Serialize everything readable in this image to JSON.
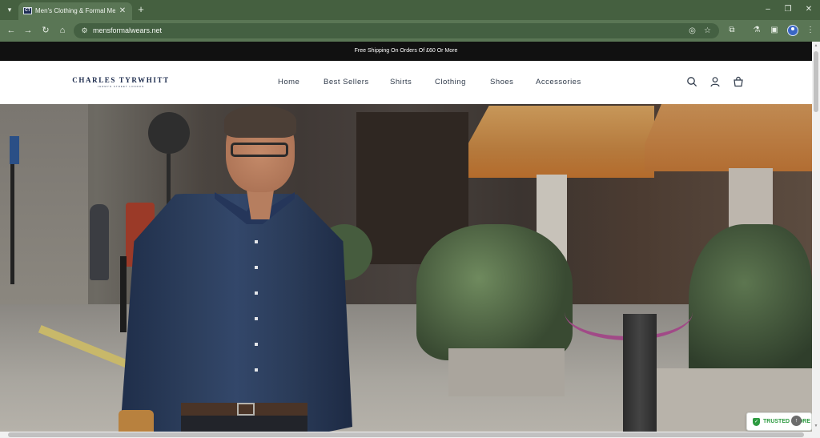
{
  "browser": {
    "tab_title": "Men's Clothing & Formal Men",
    "favicon_text": "CT",
    "tab_close": "✕",
    "new_tab": "+",
    "url": "mensformalwears.net",
    "icons": [
      "tab-search-icon",
      "back-icon",
      "forward-icon",
      "reload-icon",
      "home-icon",
      "site-info-icon",
      "eye-off-icon",
      "star-icon",
      "extensions-icon",
      "labs-icon",
      "sidebar-icon",
      "profile-icon",
      "menu-icon",
      "minimize-icon",
      "maximize-icon",
      "close-window-icon"
    ]
  },
  "announcement": {
    "text": "Free Shipping On Orders Of £60 Or More"
  },
  "header": {
    "logo_main": "CHARLES TYRWHITT",
    "logo_sub": "JERMYN STREET LONDON",
    "nav": [
      "Home",
      "Best Sellers",
      "Shirts",
      "Clothing",
      "Shoes",
      "Accessories"
    ],
    "icons": [
      "search-icon",
      "account-icon",
      "cart-icon"
    ]
  },
  "hero": {
    "image": "man-in-denim-shirt-walking-on-street",
    "accent_color": "#2c3e5c"
  },
  "badge": {
    "trusted_text": "TRUSTED STORE",
    "color": "#2e9b41"
  },
  "colors": {
    "tab_bar": "#456040",
    "toolbar": "#5a7655",
    "announcement_bg": "#111111",
    "nav_text": "#2f3a4a",
    "logo": "#1b2a4c"
  }
}
